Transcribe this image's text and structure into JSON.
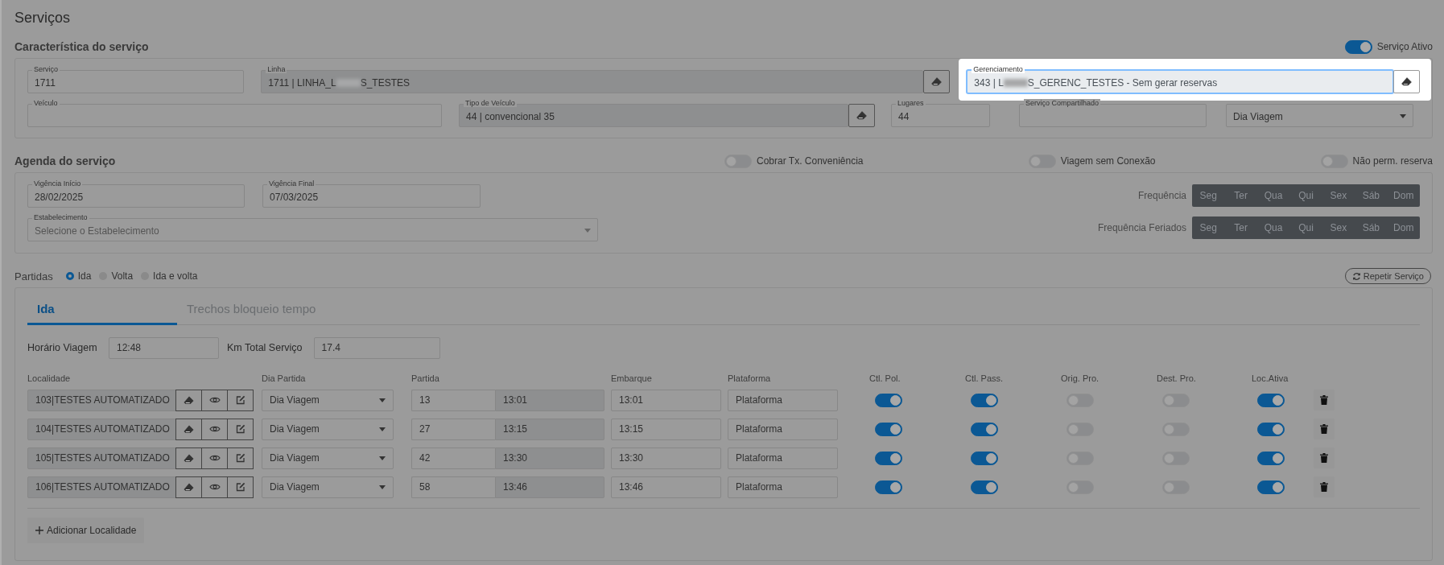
{
  "page_title": "Serviços",
  "characteristics": {
    "heading": "Característica do serviço",
    "active_toggle": {
      "label": "Serviço Ativo",
      "on": true
    },
    "top_line": [
      {
        "kind": "text",
        "label": "Serviço",
        "value": "1711",
        "disabled": false,
        "highlighted": false
      },
      {
        "kind": "lookup",
        "label": "Linha",
        "value": "1711 | LINHA_L",
        "value_after_redaction": "S_TESTES",
        "disabled": true,
        "highlighted": false
      },
      {
        "kind": "lookup",
        "label": "Gerenciamento",
        "value": "343 | L",
        "value_after_redaction": "S_GERENC_TESTES - Sem gerar reservas",
        "disabled": true,
        "highlighted": true
      }
    ],
    "bottom_line": [
      {
        "kind": "text",
        "label": "Veículo",
        "disabled": false,
        "highlighted": false
      },
      {
        "kind": "lookup",
        "label": "Tipo de Veículo",
        "value": "44 | convencional 35",
        "disabled": true,
        "highlighted": false
      },
      {
        "kind": "text",
        "label": "Lugares",
        "value": "44",
        "disabled": false,
        "highlighted": false
      },
      {
        "kind": "text",
        "label": "Serviço Compartilhado",
        "disabled": false,
        "highlighted": false
      },
      {
        "kind": "select",
        "value": "Dia Viagem",
        "disabled": false,
        "highlighted": false
      }
    ]
  },
  "schedule": {
    "heading": "Agenda do serviço",
    "toggles": [
      {
        "label": "Cobrar Tx. Conveniência",
        "on": false
      },
      {
        "label": "Viagem sem Conexão",
        "on": false
      },
      {
        "label": "Não perm. reserva",
        "on": false
      }
    ],
    "fields": [
      {
        "kind": "text",
        "label": "Vigência Início",
        "value": "28/02/2025"
      },
      {
        "kind": "text",
        "label": "Vigência Final",
        "value": "07/03/2025"
      },
      {
        "kind": "select",
        "label": "Estabelecimento",
        "placeholder": "Selecione o Estabelecimento"
      }
    ],
    "frequencies": [
      {
        "label": "Frequência",
        "days": [
          "Seg",
          "Ter",
          "Qua",
          "Qui",
          "Sex",
          "Sáb",
          "Dom"
        ]
      },
      {
        "label": "Frequência Feriados",
        "days": [
          "Seg",
          "Ter",
          "Qua",
          "Qui",
          "Sex",
          "Sáb",
          "Dom"
        ]
      }
    ]
  },
  "departures": {
    "heading": "Partidas",
    "directions": [
      {
        "label": "Ida",
        "selected": true
      },
      {
        "label": "Volta",
        "selected": false
      },
      {
        "label": "Ida e volta",
        "selected": false
      }
    ],
    "repeat_button": "Repetir Serviço",
    "tabs": [
      {
        "label": "Ida",
        "selected": true
      },
      {
        "label": "Trechos bloqueio tempo",
        "selected": false
      }
    ],
    "trip_time": {
      "label": "Horário Viagem",
      "value": "12:48"
    },
    "total_km": {
      "label": "Km Total Serviço",
      "value": "17.4"
    },
    "columns": [
      "Localidade",
      "Dia Partida",
      "Partida",
      "Embarque",
      "Plataforma",
      "Ctl. Pol.",
      "Ctl. Pass.",
      "Orig. Pro.",
      "Dest. Pro.",
      "Loc.Ativa"
    ],
    "stops": [
      {
        "locality": "103|TESTES AUTOMATIZADO",
        "day": "Dia Viagem",
        "minutes": "13",
        "departure": "13:01",
        "boarding": "13:01",
        "platform_placeholder": "Plataforma",
        "ctl_pol": true,
        "ctl_pass": true,
        "orig_pro": false,
        "dest_pro": false,
        "loc_active": true
      },
      {
        "locality": "104|TESTES AUTOMATIZADO",
        "day": "Dia Viagem",
        "minutes": "27",
        "departure": "13:15",
        "boarding": "13:15",
        "platform_placeholder": "Plataforma",
        "ctl_pol": true,
        "ctl_pass": true,
        "orig_pro": false,
        "dest_pro": false,
        "loc_active": true
      },
      {
        "locality": "105|TESTES AUTOMATIZADO",
        "day": "Dia Viagem",
        "minutes": "42",
        "departure": "13:30",
        "boarding": "13:30",
        "platform_placeholder": "Plataforma",
        "ctl_pol": true,
        "ctl_pass": true,
        "orig_pro": false,
        "dest_pro": false,
        "loc_active": true
      },
      {
        "locality": "106|TESTES AUTOMATIZADO",
        "day": "Dia Viagem",
        "minutes": "58",
        "departure": "13:46",
        "boarding": "13:46",
        "platform_placeholder": "Plataforma",
        "ctl_pol": true,
        "ctl_pass": true,
        "orig_pro": false,
        "dest_pro": false,
        "loc_active": true
      }
    ],
    "add_button": "Adicionar Localidade"
  }
}
